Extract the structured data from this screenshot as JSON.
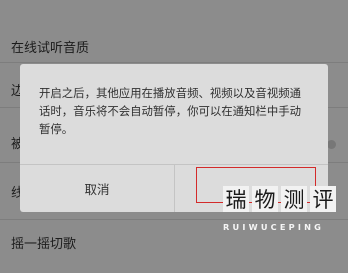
{
  "settings": {
    "row1_label": "在线试听音质",
    "row2_partial": "边",
    "row3_partial": "被",
    "row4_partial": "线",
    "row5_label": "摇一摇切歌"
  },
  "dialog": {
    "message": "开启之后，其他应用在播放音频、视频以及音视频通话时，音乐将不会自动暂停，你可以在通知栏中手动暂停。",
    "cancel_label": "取消",
    "confirm_label": ""
  },
  "watermark": {
    "glyphs": [
      "瑞",
      "物",
      "测",
      "评"
    ],
    "latin": "RUIWUCEPING"
  },
  "colors": {
    "highlight": "#d32a2a",
    "dim_overlay": "#8c8c8c"
  }
}
